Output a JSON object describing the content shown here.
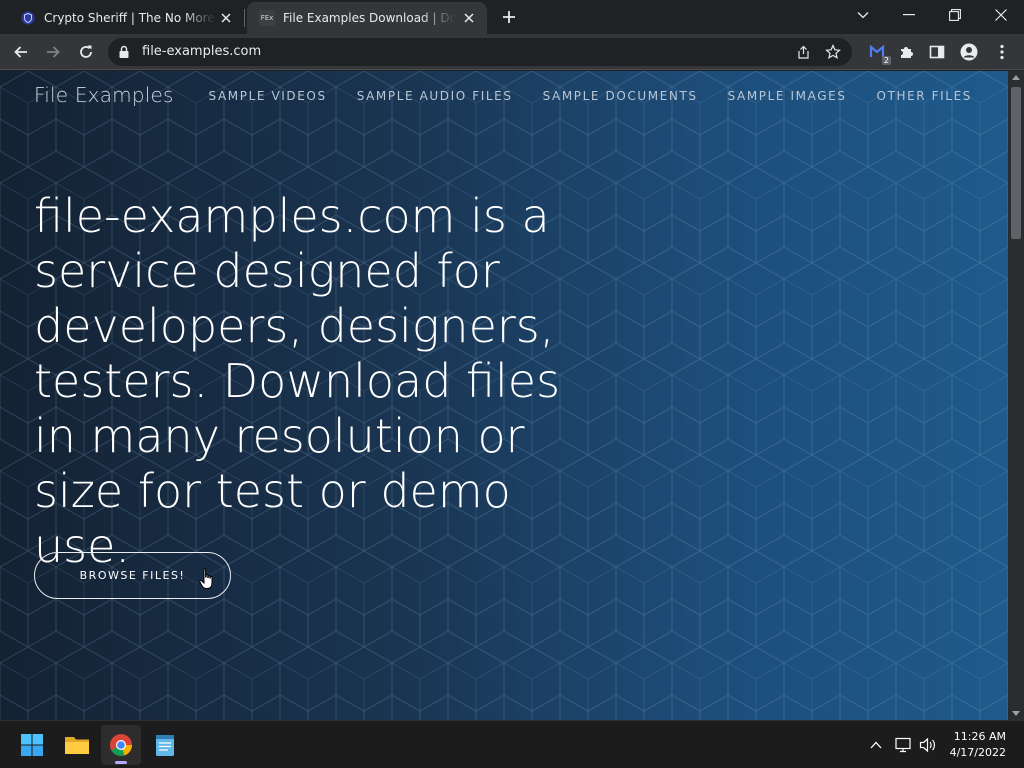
{
  "browser": {
    "tabs": [
      {
        "title": "Crypto Sheriff | The No More Ransom Project",
        "favicon": "shield-icon",
        "active": false
      },
      {
        "title": "File Examples Download | Download Sample Files",
        "favicon": "fex-favicon",
        "favicon_text": "FEx",
        "active": true
      }
    ],
    "url": "file-examples.com",
    "extension_badge": "2"
  },
  "site": {
    "brand": "File Examples",
    "nav": [
      "SAMPLE VIDEOS",
      "SAMPLE AUDIO FILES",
      "SAMPLE DOCUMENTS",
      "SAMPLE IMAGES",
      "OTHER FILES"
    ],
    "hero_text": "file-examples.com is a service designed for developers, designers, testers. Download files in many resolution or size for test or demo use.",
    "cta_label": "BROWSE FILES!"
  },
  "taskbar": {
    "apps": [
      "windows-start",
      "file-explorer",
      "chrome",
      "notepad"
    ],
    "time": "11:26 AM",
    "date": "4/17/2022"
  },
  "colors": {
    "page_gradient_left": "#142233",
    "page_gradient_right": "#1e5a8c",
    "chrome_dark": "#202124",
    "chrome_toolbar": "#35363a"
  }
}
